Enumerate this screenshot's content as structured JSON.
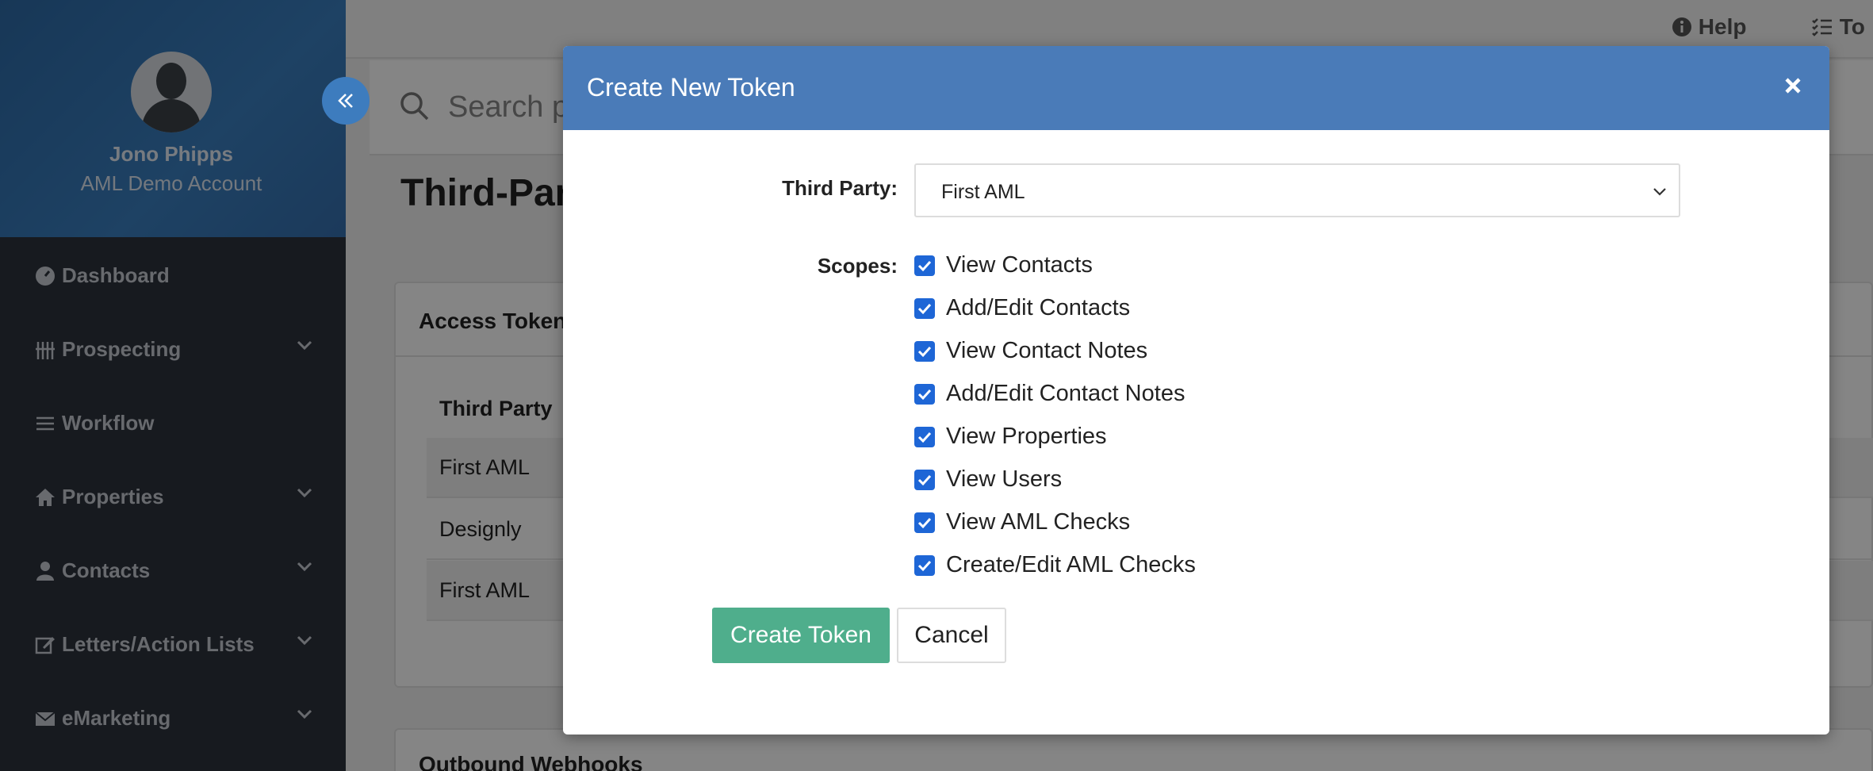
{
  "sidebar": {
    "profile": {
      "name": "Jono Phipps",
      "account": "AML Demo Account"
    },
    "collapse_icon": "double-chevron-left-icon",
    "items": [
      {
        "label": "Dashboard",
        "icon": "dashboard-icon",
        "expandable": false
      },
      {
        "label": "Prospecting",
        "icon": "prospecting-icon",
        "expandable": true
      },
      {
        "label": "Workflow",
        "icon": "list-icon",
        "expandable": false
      },
      {
        "label": "Properties",
        "icon": "home-icon",
        "expandable": true
      },
      {
        "label": "Contacts",
        "icon": "user-icon",
        "expandable": true
      },
      {
        "label": "Letters/Action Lists",
        "icon": "edit-icon",
        "expandable": true
      },
      {
        "label": "eMarketing",
        "icon": "envelope-icon",
        "expandable": true
      }
    ]
  },
  "topbar": {
    "help_label": "Help",
    "todo_label": "To"
  },
  "search": {
    "placeholder": "Search p"
  },
  "page": {
    "title": "Third-Par",
    "access_tokens": {
      "title": "Access Tokens",
      "column_header": "Third Party",
      "rows": [
        "First AML",
        "Designly",
        "First AML"
      ]
    },
    "webhooks_title": "Outbound Webhooks"
  },
  "modal": {
    "title": "Create New Token",
    "close_icon": "close-icon",
    "third_party_label": "Third Party:",
    "third_party_value": "First AML",
    "scopes_label": "Scopes:",
    "scopes": [
      {
        "label": "View Contacts",
        "checked": true
      },
      {
        "label": "Add/Edit Contacts",
        "checked": true
      },
      {
        "label": "View Contact Notes",
        "checked": true
      },
      {
        "label": "Add/Edit Contact Notes",
        "checked": true
      },
      {
        "label": "View Properties",
        "checked": true
      },
      {
        "label": "View Users",
        "checked": true
      },
      {
        "label": "View AML Checks",
        "checked": true
      },
      {
        "label": "Create/Edit AML Checks",
        "checked": true
      }
    ],
    "create_button": "Create Token",
    "cancel_button": "Cancel"
  },
  "colors": {
    "modal_header": "#4a7bb8",
    "primary_button": "#4fae8c",
    "checkbox": "#1e66d6",
    "sidebar": "#2c323d"
  }
}
